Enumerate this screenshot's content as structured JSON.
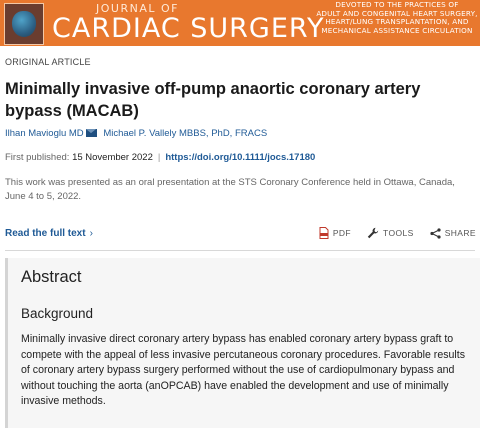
{
  "banner": {
    "journal_of": "JOURNAL OF",
    "journal_name": "CARDIAC SURGERY",
    "tagline": [
      "DEVOTED TO THE PRACTICES OF",
      "ADULT AND CONGENITAL HEART SURGERY,",
      "HEART/LUNG TRANSPLANTATION, AND",
      "MECHANICAL ASSISTANCE CIRCULATION"
    ],
    "color": "#e8782e"
  },
  "article": {
    "type": "ORIGINAL ARTICLE",
    "title": "Minimally invasive off-pump anaortic coronary artery bypass (MACAB)",
    "authors": [
      {
        "name": "Ilhan Mavioglu MD",
        "has_email_icon": true
      },
      {
        "name": "Michael P. Vallely MBBS, PhD, FRACS",
        "has_email_icon": false
      }
    ],
    "first_published_label": "First published:",
    "first_published_date": "15 November 2022",
    "doi": "https://doi.org/10.1111/jocs.17180",
    "note": "This work was presented as an oral presentation at the STS Coronary Conference held in Ottawa, Canada, June 4 to 5, 2022.",
    "read_full_text": "Read the full text",
    "actions": {
      "pdf": "PDF",
      "tools": "TOOLS",
      "share": "SHARE"
    },
    "icons": {
      "pdf": "pdf-icon",
      "tools": "wrench-icon",
      "share": "share-icon",
      "read": "chevron-right-icon",
      "email": "email-icon"
    }
  },
  "abstract": {
    "heading": "Abstract",
    "section_heading": "Background",
    "text": "Minimally invasive direct coronary artery bypass has enabled coronary artery bypass graft to compete with the appeal of less invasive percutaneous coronary procedures. Favorable results of coronary artery bypass surgery performed without the use of cardiopulmonary bypass and without touching the aorta (anOPCAB) have enabled the development and use of minimally invasive methods."
  }
}
